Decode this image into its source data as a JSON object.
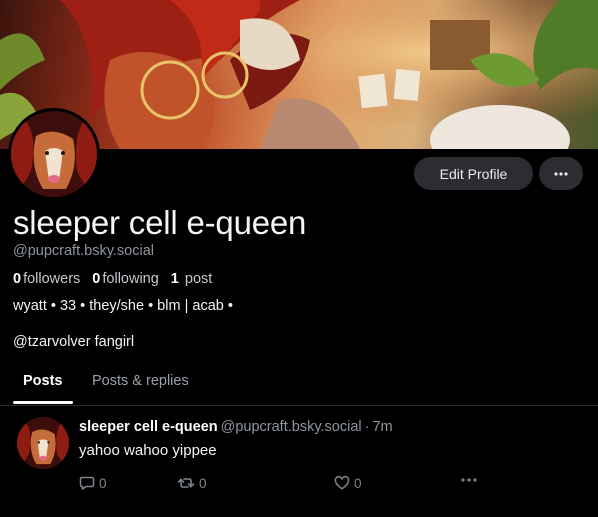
{
  "profile": {
    "display_name": "sleeper cell e-queen",
    "handle": "@pupcraft.bsky.social",
    "stats": {
      "followers_count": "0",
      "followers_label": "followers",
      "following_count": "0",
      "following_label": "following",
      "posts_count": "1",
      "posts_label": "post"
    },
    "bio_line1": "wyatt • 33 • they/she • blm | acab •",
    "bio_line2": "@tzarvolver fangirl"
  },
  "buttons": {
    "edit_profile": "Edit Profile",
    "more_icon": "ellipsis-icon"
  },
  "tabs": [
    {
      "label": "Posts",
      "active": true
    },
    {
      "label": "Posts & replies",
      "active": false
    }
  ],
  "post": {
    "author_name": "sleeper cell e-queen",
    "author_handle": "@pupcraft.bsky.social",
    "separator": "·",
    "time": "7m",
    "text": "yahoo wahoo yippee",
    "reply_count": "0",
    "repost_count": "0",
    "like_count": "0",
    "icons": [
      "reply-icon",
      "repost-icon",
      "heart-icon",
      "ellipsis-icon"
    ]
  },
  "colors": {
    "background": "#000000",
    "button_bg": "#2b2d32",
    "muted_text": "#8e959d",
    "divider": "#2a2d31"
  }
}
